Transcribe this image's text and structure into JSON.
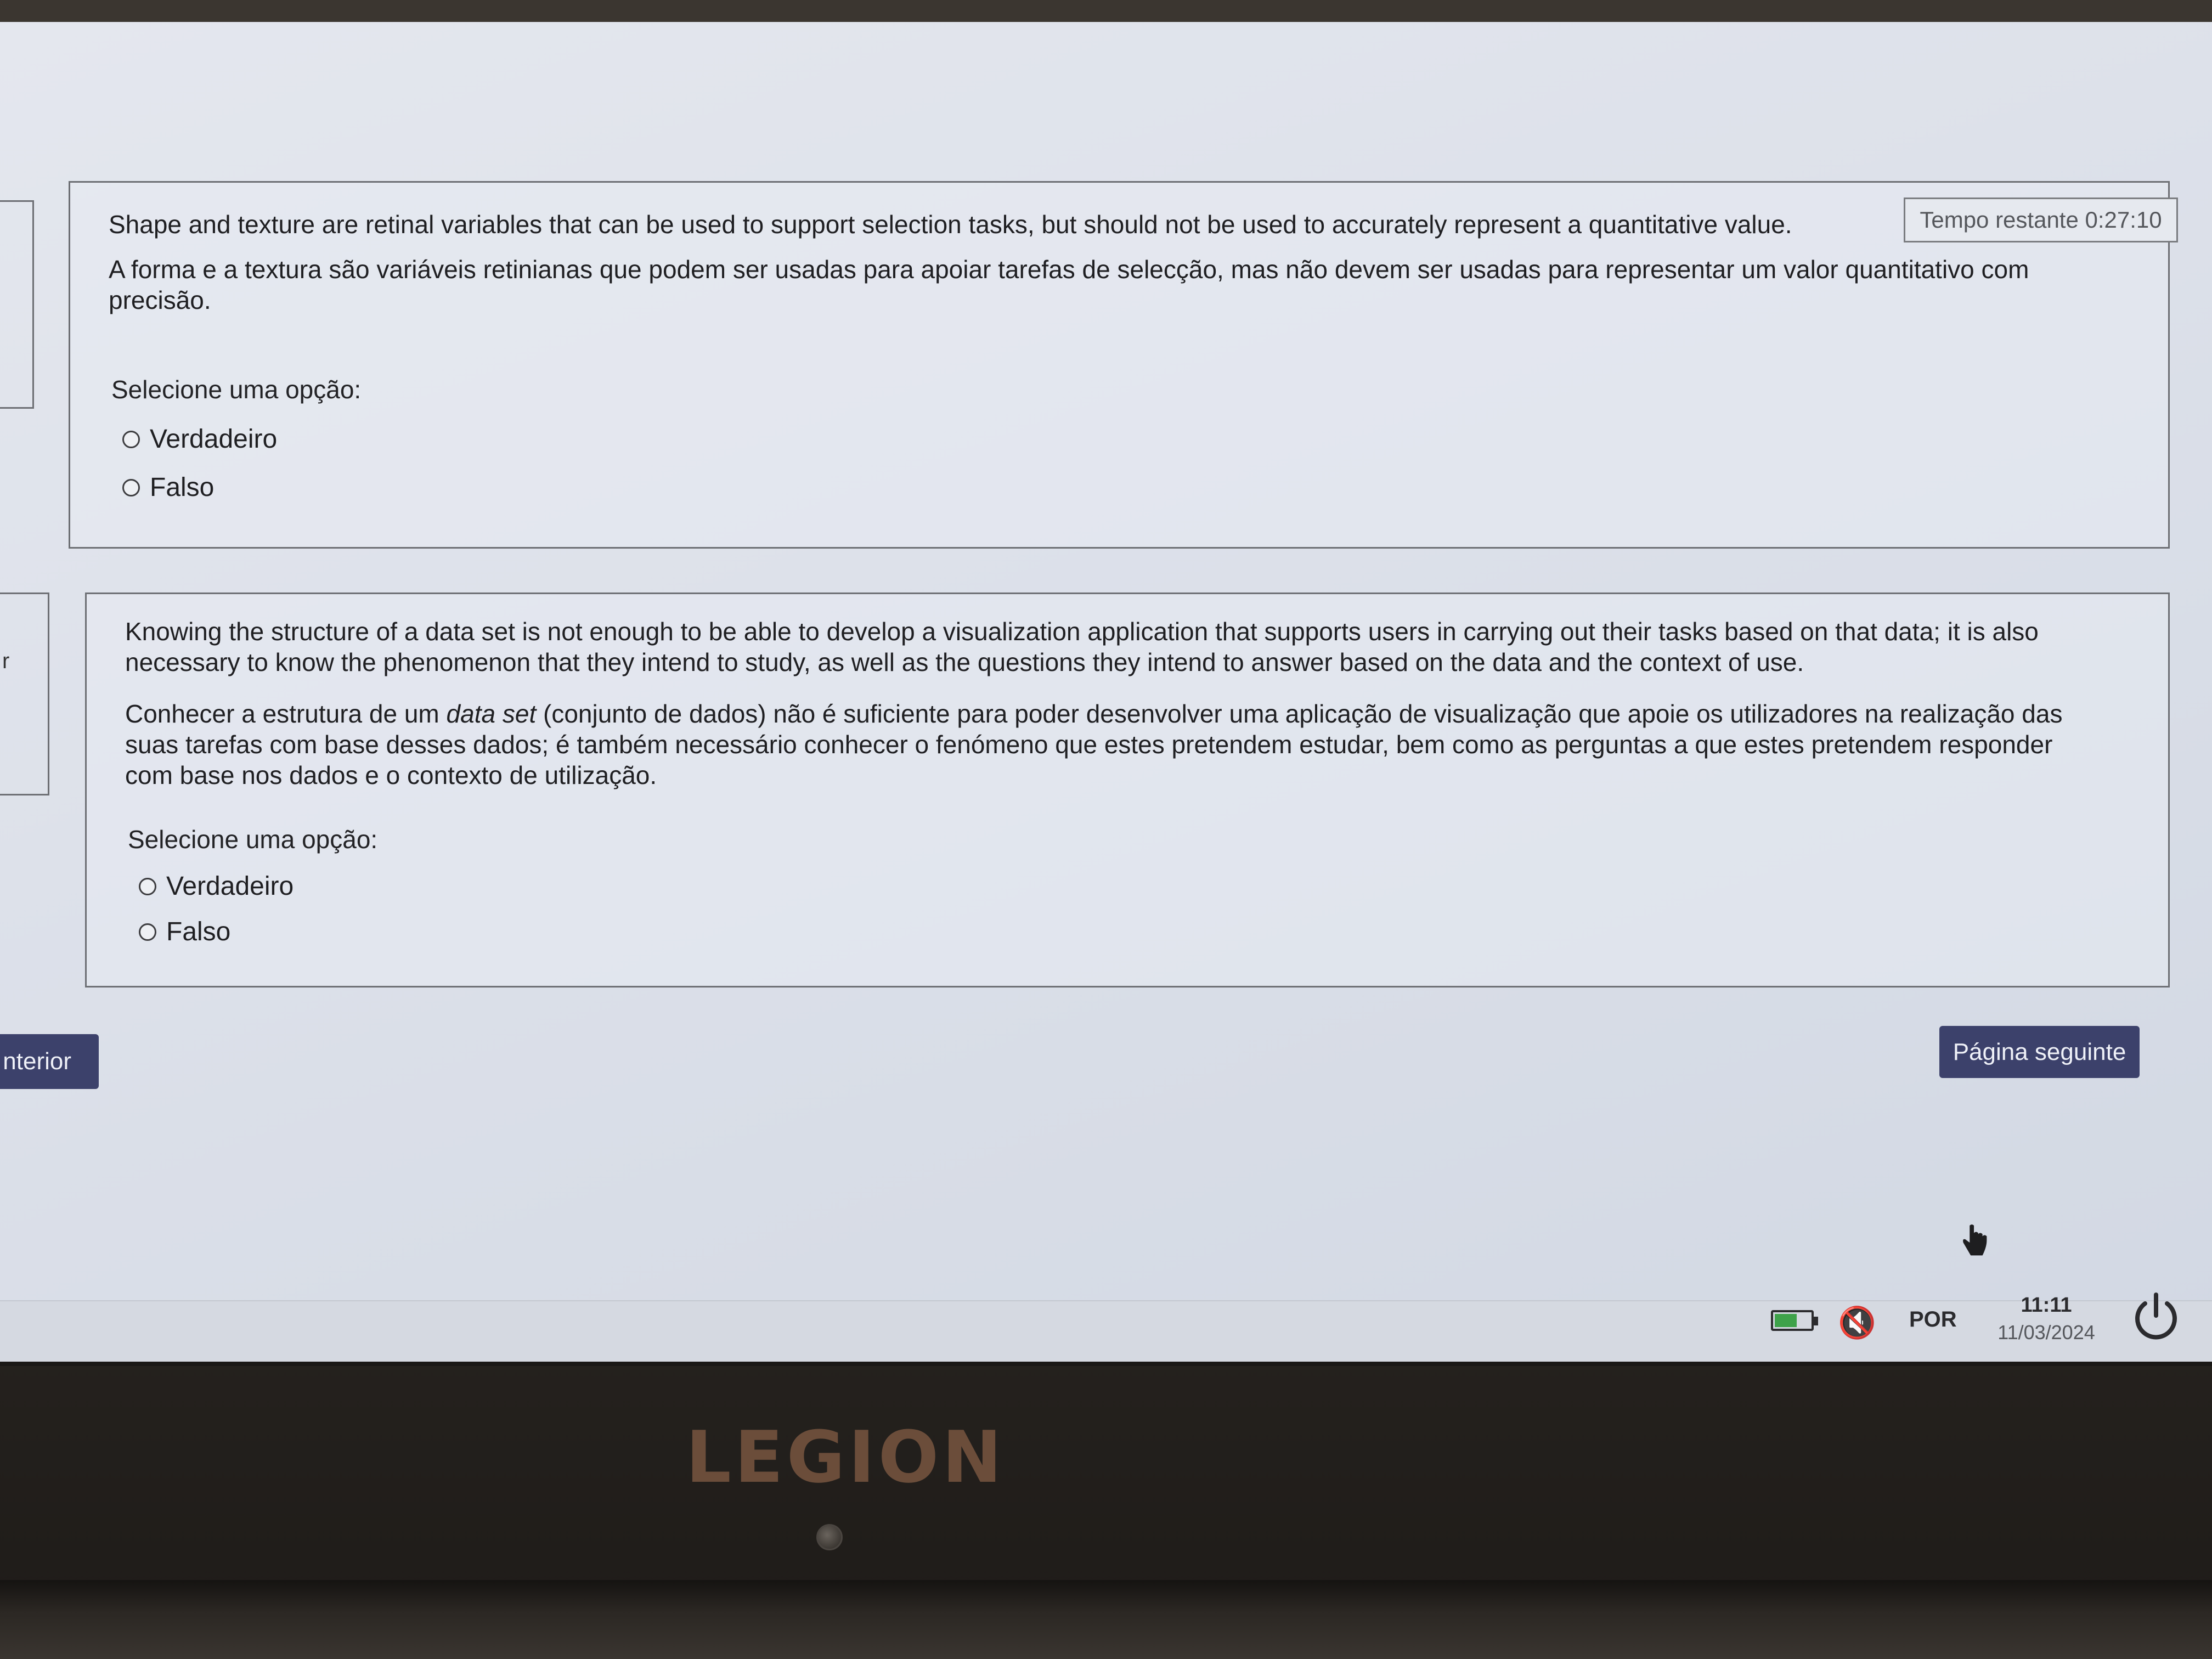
{
  "timer": {
    "label": "Tempo restante 0:27:10"
  },
  "questions": [
    {
      "text_en": "Shape and texture are retinal variables that can be used to support selection tasks, but should not be used to accurately represent a quantitative value.",
      "text_pt": "A forma e a textura são variáveis retinianas que podem ser usadas para apoiar tarefas de selecção, mas não devem ser usadas para representar um valor quantitativo com precisão.",
      "prompt": "Selecione uma opção:",
      "options": [
        "Verdadeiro",
        "Falso"
      ]
    },
    {
      "text_en": "Knowing the structure of a data set is not enough to be able to develop a visualization application that supports users in carrying out their tasks based on that data; it is also necessary to know the phenomenon that they intend to study, as well as the questions they intend to answer based on the data and the context of use.",
      "text_pt_before": "Conhecer a estrutura de um ",
      "text_pt_italic": "data set",
      "text_pt_after": " (conjunto de dados) não é suficiente para poder desenvolver uma aplicação de visualização que apoie os utilizadores na realização das suas tarefas com base desses dados; é também necessário conhecer o fenómeno que estes pretendem estudar, bem como as perguntas a que estes pretendem responder com base nos dados e o contexto de utilização.",
      "prompt": "Selecione uma opção:",
      "options": [
        "Verdadeiro",
        "Falso"
      ]
    }
  ],
  "navigation": {
    "prev_label": "nterior",
    "next_label": "Página seguinte"
  },
  "side_fragment_text": "r",
  "taskbar": {
    "battery_icon": "battery-icon",
    "volume_icon": "volume-muted-icon",
    "volume_glyph": "🔇",
    "language": "POR",
    "time": "11:11",
    "date": "11/03/2024",
    "power_icon": "power-icon"
  },
  "bezel": {
    "brand": "LEGION"
  },
  "colors": {
    "button_bg": "#3c416b",
    "battery_fill": "#3ea24a",
    "logo": "#6b4d3a"
  }
}
